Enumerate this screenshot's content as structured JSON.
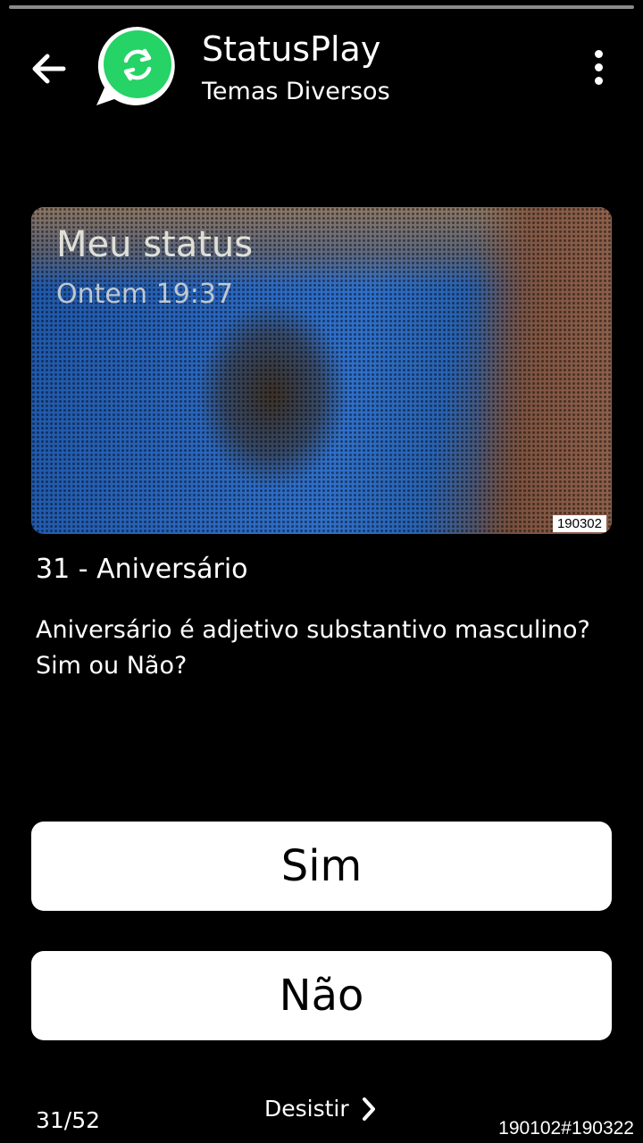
{
  "header": {
    "title": "StatusPlay",
    "subtitle": "Temas Diversos",
    "back_icon": "arrow-left-icon",
    "menu_icon": "more-vertical-icon",
    "logo_color": "#25D366"
  },
  "status_image": {
    "label": "Meu status",
    "time": "Ontem 19:37",
    "image_id": "190302"
  },
  "question": {
    "title": "31 - Aniversário",
    "text": "Aniversário é adjetivo substantivo masculino? Sim ou Não?"
  },
  "answers": {
    "yes": "Sim",
    "no": "Não"
  },
  "footer": {
    "progress": "31/52",
    "quit_label": "Desistir",
    "quit_icon": "chevron-right-icon",
    "code": "190102#190322"
  }
}
